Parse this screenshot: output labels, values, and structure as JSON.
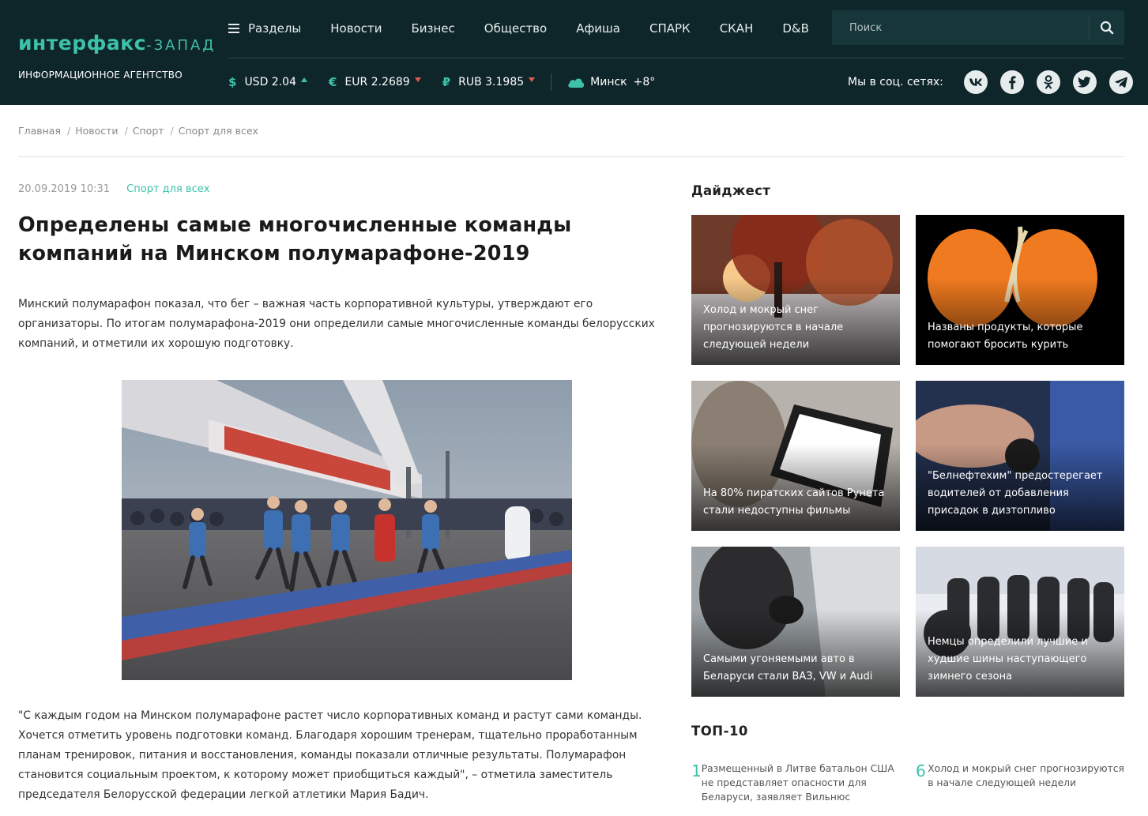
{
  "header": {
    "logo_main": "интерфакс",
    "logo_suffix": "-ЗАПАД",
    "logo_sub": "ИНФОРМАЦИОННОЕ АГЕНТСТВО",
    "nav": [
      "Разделы",
      "Новости",
      "Бизнес",
      "Общество",
      "Афиша",
      "СПАРК",
      "СКАН",
      "D&B"
    ],
    "search_placeholder": "Поиск",
    "rates": [
      {
        "symbol": "$",
        "label": "USD 2.04",
        "trend": "up"
      },
      {
        "symbol": "€",
        "label": "EUR 2.2689",
        "trend": "down"
      },
      {
        "symbol": "₽",
        "label": "RUB 3.1985",
        "trend": "down"
      }
    ],
    "weather": {
      "city": "Минск",
      "temp": "+8°",
      "icon": "cloud-icon"
    },
    "social_label": "Мы в соц. сетях:",
    "social": [
      "vk-icon",
      "facebook-icon",
      "odnoklassniki-icon",
      "twitter-icon",
      "telegram-icon"
    ]
  },
  "breadcrumb": [
    "Главная",
    "Новости",
    "Спорт",
    "Спорт для всех"
  ],
  "article": {
    "date": "20.09.2019 10:31",
    "category": "Спорт для всех",
    "title": "Определены самые многочисленные команды компаний на Минском полумарафоне-2019",
    "lead": "Минский полумарафон показал, что бег – важная часть корпоративной культуры, утверждают его организаторы. По итогам полумарафона-2019 они определили самые многочисленные команды белорусских компаний, и отметили их хорошую подготовку.",
    "quote": "\"С каждым годом на Минском полумарафоне растет число корпоративных команд и растут сами команды. Хочется отметить уровень подготовки команд. Благодаря хорошим тренерам, тщательно проработанным планам тренировок, питания и восстановления, команды показали отличные результаты. Полумарафон становится социальным проектом, к которому может приобщиться каждый\", – отметила заместитель председателя Белорусской федерации легкой атлетики Мария Бадич."
  },
  "digest": {
    "title": "Дайджест",
    "cards": [
      {
        "caption": "Холод и мокрый снег прогнозируются в начале следующей недели"
      },
      {
        "caption": "Названы продукты, которые помогают бросить курить"
      },
      {
        "caption": "На 80% пиратских сайтов Рунета стали недоступны фильмы"
      },
      {
        "caption": "\"Белнефтехим\" предостерегает водителей от добавления присадок в дизтопливо"
      },
      {
        "caption": "Самыми угоняемыми авто в Беларуси стали ВАЗ, VW и Audi"
      },
      {
        "caption": "Немцы определили лучшие и худшие шины наступающего зимнего сезона"
      }
    ]
  },
  "top10": {
    "title": "ТОП-10",
    "items": [
      {
        "num": "1",
        "text": "Размещенный в Литве батальон США не представляет опасности для Беларуси, заявляет Вильнюс"
      },
      {
        "num": "6",
        "text": "Холод и мокрый снег прогнозируются в начале следующей недели"
      }
    ]
  },
  "colors": {
    "header_bg": "#0e2529",
    "accent": "#3ec1a9",
    "down": "#e25a4f"
  }
}
